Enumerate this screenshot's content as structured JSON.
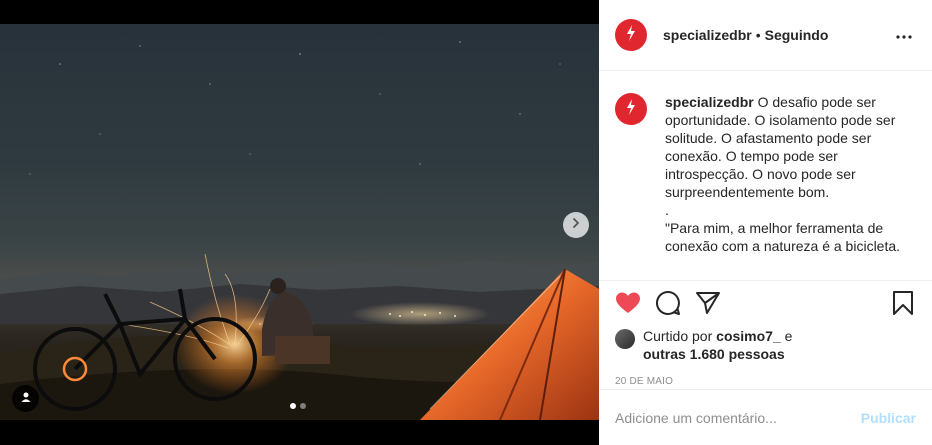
{
  "post": {
    "username": "specializedbr",
    "separator": "•",
    "follow_status": "Seguindo",
    "caption": {
      "username": "specializedbr",
      "text": "O desafio pode ser oportunidade. O isolamento pode ser solitude. O afastamento pode ser conexão. O tempo pode ser introspecção. O novo pode ser surpreendentemente bom.",
      "dot_line": ".",
      "quote": "\"Para mim, a melhor ferramenta de conexão com a natureza é a bicicleta."
    },
    "likes": {
      "prefix": "Curtido por",
      "liked_by": "cosimo7_",
      "conjunction": "e",
      "others": "outras 1.680 pessoas"
    },
    "date": "20 DE MAIO",
    "comment": {
      "placeholder": "Adicione um comentário...",
      "publish_label": "Publicar"
    }
  },
  "carousel": {
    "total": 2,
    "current": 1
  },
  "icons": {
    "brand": "specialized-logo-icon",
    "more": "more-options-icon",
    "like": "heart-icon",
    "comment": "comment-icon",
    "share": "share-icon",
    "save": "bookmark-icon",
    "next": "chevron-right-icon",
    "tag": "user-tag-icon"
  },
  "colors": {
    "brand_red": "#e0262e",
    "like_red": "#ed4956",
    "publish_disabled": "#b2dffc"
  }
}
